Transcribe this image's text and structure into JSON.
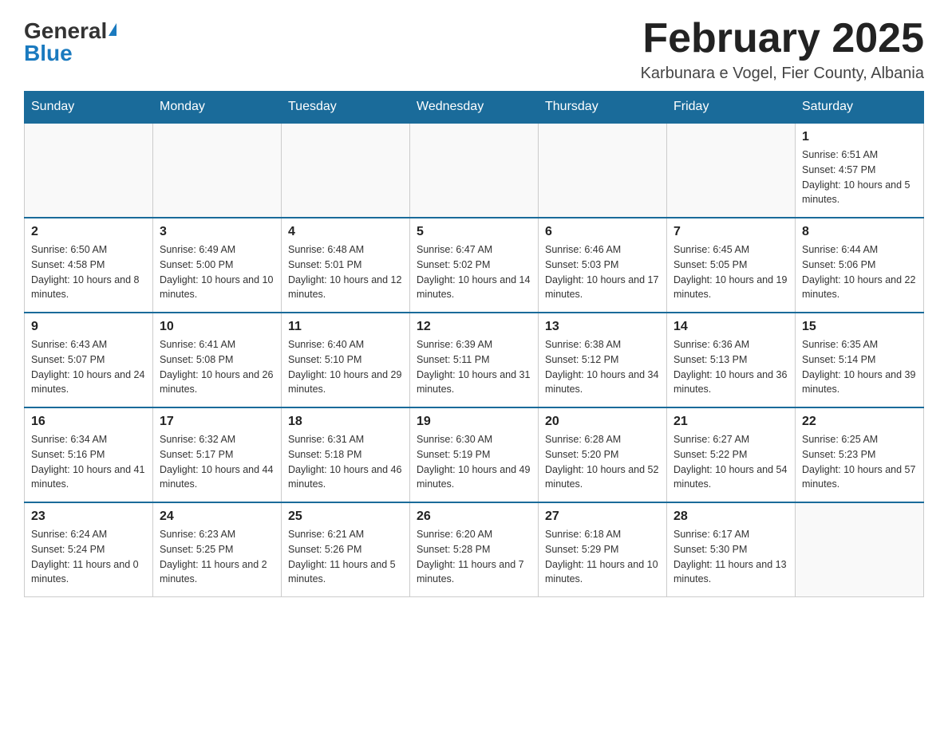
{
  "header": {
    "logo_general": "General",
    "logo_blue": "Blue",
    "month_title": "February 2025",
    "location": "Karbunara e Vogel, Fier County, Albania"
  },
  "weekdays": [
    "Sunday",
    "Monday",
    "Tuesday",
    "Wednesday",
    "Thursday",
    "Friday",
    "Saturday"
  ],
  "weeks": [
    [
      {
        "day": "",
        "info": ""
      },
      {
        "day": "",
        "info": ""
      },
      {
        "day": "",
        "info": ""
      },
      {
        "day": "",
        "info": ""
      },
      {
        "day": "",
        "info": ""
      },
      {
        "day": "",
        "info": ""
      },
      {
        "day": "1",
        "info": "Sunrise: 6:51 AM\nSunset: 4:57 PM\nDaylight: 10 hours and 5 minutes."
      }
    ],
    [
      {
        "day": "2",
        "info": "Sunrise: 6:50 AM\nSunset: 4:58 PM\nDaylight: 10 hours and 8 minutes."
      },
      {
        "day": "3",
        "info": "Sunrise: 6:49 AM\nSunset: 5:00 PM\nDaylight: 10 hours and 10 minutes."
      },
      {
        "day": "4",
        "info": "Sunrise: 6:48 AM\nSunset: 5:01 PM\nDaylight: 10 hours and 12 minutes."
      },
      {
        "day": "5",
        "info": "Sunrise: 6:47 AM\nSunset: 5:02 PM\nDaylight: 10 hours and 14 minutes."
      },
      {
        "day": "6",
        "info": "Sunrise: 6:46 AM\nSunset: 5:03 PM\nDaylight: 10 hours and 17 minutes."
      },
      {
        "day": "7",
        "info": "Sunrise: 6:45 AM\nSunset: 5:05 PM\nDaylight: 10 hours and 19 minutes."
      },
      {
        "day": "8",
        "info": "Sunrise: 6:44 AM\nSunset: 5:06 PM\nDaylight: 10 hours and 22 minutes."
      }
    ],
    [
      {
        "day": "9",
        "info": "Sunrise: 6:43 AM\nSunset: 5:07 PM\nDaylight: 10 hours and 24 minutes."
      },
      {
        "day": "10",
        "info": "Sunrise: 6:41 AM\nSunset: 5:08 PM\nDaylight: 10 hours and 26 minutes."
      },
      {
        "day": "11",
        "info": "Sunrise: 6:40 AM\nSunset: 5:10 PM\nDaylight: 10 hours and 29 minutes."
      },
      {
        "day": "12",
        "info": "Sunrise: 6:39 AM\nSunset: 5:11 PM\nDaylight: 10 hours and 31 minutes."
      },
      {
        "day": "13",
        "info": "Sunrise: 6:38 AM\nSunset: 5:12 PM\nDaylight: 10 hours and 34 minutes."
      },
      {
        "day": "14",
        "info": "Sunrise: 6:36 AM\nSunset: 5:13 PM\nDaylight: 10 hours and 36 minutes."
      },
      {
        "day": "15",
        "info": "Sunrise: 6:35 AM\nSunset: 5:14 PM\nDaylight: 10 hours and 39 minutes."
      }
    ],
    [
      {
        "day": "16",
        "info": "Sunrise: 6:34 AM\nSunset: 5:16 PM\nDaylight: 10 hours and 41 minutes."
      },
      {
        "day": "17",
        "info": "Sunrise: 6:32 AM\nSunset: 5:17 PM\nDaylight: 10 hours and 44 minutes."
      },
      {
        "day": "18",
        "info": "Sunrise: 6:31 AM\nSunset: 5:18 PM\nDaylight: 10 hours and 46 minutes."
      },
      {
        "day": "19",
        "info": "Sunrise: 6:30 AM\nSunset: 5:19 PM\nDaylight: 10 hours and 49 minutes."
      },
      {
        "day": "20",
        "info": "Sunrise: 6:28 AM\nSunset: 5:20 PM\nDaylight: 10 hours and 52 minutes."
      },
      {
        "day": "21",
        "info": "Sunrise: 6:27 AM\nSunset: 5:22 PM\nDaylight: 10 hours and 54 minutes."
      },
      {
        "day": "22",
        "info": "Sunrise: 6:25 AM\nSunset: 5:23 PM\nDaylight: 10 hours and 57 minutes."
      }
    ],
    [
      {
        "day": "23",
        "info": "Sunrise: 6:24 AM\nSunset: 5:24 PM\nDaylight: 11 hours and 0 minutes."
      },
      {
        "day": "24",
        "info": "Sunrise: 6:23 AM\nSunset: 5:25 PM\nDaylight: 11 hours and 2 minutes."
      },
      {
        "day": "25",
        "info": "Sunrise: 6:21 AM\nSunset: 5:26 PM\nDaylight: 11 hours and 5 minutes."
      },
      {
        "day": "26",
        "info": "Sunrise: 6:20 AM\nSunset: 5:28 PM\nDaylight: 11 hours and 7 minutes."
      },
      {
        "day": "27",
        "info": "Sunrise: 6:18 AM\nSunset: 5:29 PM\nDaylight: 11 hours and 10 minutes."
      },
      {
        "day": "28",
        "info": "Sunrise: 6:17 AM\nSunset: 5:30 PM\nDaylight: 11 hours and 13 minutes."
      },
      {
        "day": "",
        "info": ""
      }
    ]
  ]
}
